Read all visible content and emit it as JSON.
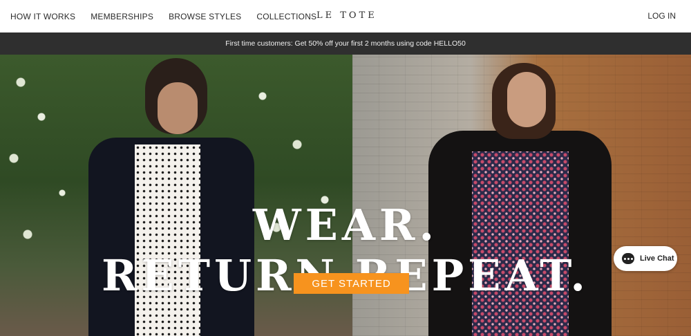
{
  "nav": {
    "links": [
      "HOW IT WORKS",
      "MEMBERSHIPS",
      "BROWSE STYLES",
      "COLLECTIONS"
    ],
    "logo": "LE TOTE",
    "login": "LOG IN"
  },
  "promo": {
    "text": "First time customers: Get 50% off your first 2 months using code HELLO50"
  },
  "hero": {
    "headline": "WEAR. RETURN.REPEAT.",
    "cta_label": "GET STARTED",
    "cta_color": "#f7931e"
  },
  "chat": {
    "label": "Live Chat",
    "icon": "chat-bubble-icon"
  }
}
